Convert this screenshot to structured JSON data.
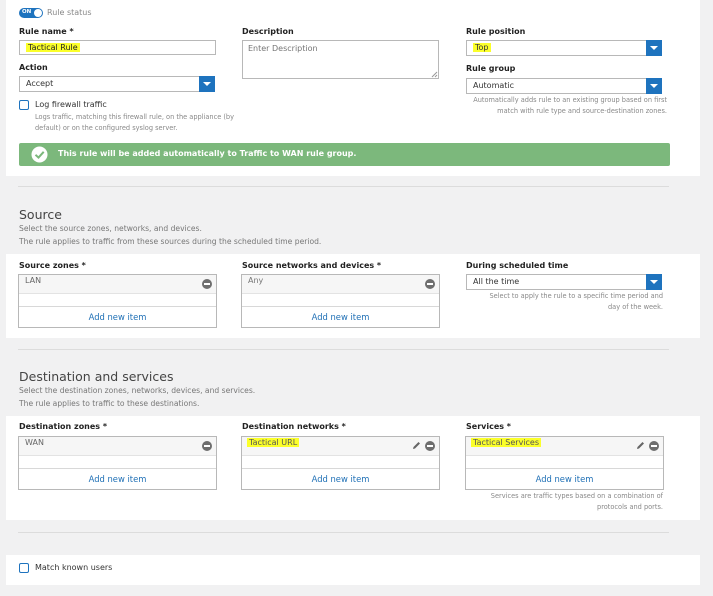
{
  "rule_status": {
    "toggle_label": "ON",
    "label": "Rule status"
  },
  "rule_name": {
    "label": "Rule name *",
    "value": "Tactical Rule"
  },
  "description": {
    "label": "Description",
    "placeholder": "Enter Description"
  },
  "rule_position": {
    "label": "Rule position",
    "value": "Top"
  },
  "action": {
    "label": "Action",
    "value": "Accept"
  },
  "rule_group": {
    "label": "Rule group",
    "value": "Automatic",
    "help": [
      "Automatically adds rule to an existing group based on first",
      "match with rule type and source-destination zones."
    ]
  },
  "log_traffic": {
    "label": "Log firewall traffic",
    "help": [
      "Logs traffic, matching this firewall rule, on the appliance (by",
      "default) or on the configured syslog server."
    ]
  },
  "banner": {
    "text": "This rule will be added automatically to Traffic to WAN rule group."
  },
  "source": {
    "title": "Source",
    "desc1": "Select the source zones, networks, and devices.",
    "desc2": "The rule applies to traffic from these sources during the scheduled time period.",
    "zones": {
      "label": "Source zones *",
      "item": "LAN",
      "add": "Add new item"
    },
    "networks": {
      "label": "Source networks and devices *",
      "item": "Any",
      "add": "Add new item"
    },
    "schedule": {
      "label": "During scheduled time",
      "value": "All the time",
      "help": [
        "Select to apply the rule to a specific time period and",
        "day of the week."
      ]
    }
  },
  "destination": {
    "title": "Destination and services",
    "desc1": "Select the destination zones, networks, devices, and services.",
    "desc2": "The rule applies to traffic to these destinations.",
    "zones": {
      "label": "Destination zones *",
      "item": "WAN",
      "add": "Add new item"
    },
    "networks": {
      "label": "Destination networks *",
      "item": "Tactical URL",
      "add": "Add new item"
    },
    "services": {
      "label": "Services *",
      "item": "Tactical Services",
      "add": "Add new item",
      "help": [
        "Services are traffic types based on a combination of",
        "protocols and ports."
      ]
    }
  },
  "match_users": {
    "label": "Match known users"
  },
  "colors": {
    "accent": "#1e73be",
    "banner": "#7cb87c",
    "highlight": "#fbff2a",
    "link": "#1e6fb5"
  }
}
